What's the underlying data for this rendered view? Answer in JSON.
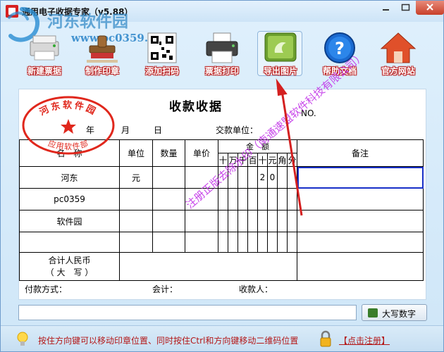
{
  "window": {
    "title": "通用电子收据专家（v5.88）",
    "watermark_title": "河东软件园",
    "watermark_url": "www.pc0359.cn"
  },
  "toolbar": {
    "items": [
      {
        "label": "新建票据",
        "icon": "printer-machine-icon"
      },
      {
        "label": "制作印章",
        "icon": "stamp-icon"
      },
      {
        "label": "添加扫码",
        "icon": "qr-code-icon"
      },
      {
        "label": "票据打印",
        "icon": "printer-icon"
      },
      {
        "label": "导出图片",
        "icon": "image-export-icon"
      },
      {
        "label": "帮助文档",
        "icon": "help-icon"
      },
      {
        "label": "官方网站",
        "icon": "home-icon"
      }
    ]
  },
  "receipt": {
    "title": "收款收据",
    "no_label": "NO.",
    "year_label": "年",
    "month_label": "月",
    "day_label": "日",
    "payer_label": "交款单位：",
    "headers": {
      "name": "名　称",
      "unit": "单位",
      "qty": "数量",
      "price": "单价",
      "amount": "金　额",
      "remark": "备注"
    },
    "amount_digits": [
      "十",
      "万",
      "千",
      "百",
      "十",
      "元",
      "角",
      "分"
    ],
    "rows": [
      {
        "name": "河东",
        "unit": "元",
        "amount_digits": [
          "",
          "",
          "",
          "",
          "2",
          "0",
          "",
          ""
        ]
      },
      {
        "name": "pc0359",
        "unit": "",
        "amount_digits": [
          "",
          "",
          "",
          "",
          "",
          "",
          "",
          ""
        ]
      },
      {
        "name": "软件园",
        "unit": "",
        "amount_digits": [
          "",
          "",
          "",
          "",
          "",
          "",
          "",
          ""
        ]
      },
      {
        "name": "",
        "unit": "",
        "amount_digits": [
          "",
          "",
          "",
          "",
          "",
          "",
          "",
          ""
        ]
      }
    ],
    "total_label_line1": "合计人民币",
    "total_label_line2": "（ 大　写 ）",
    "payment_method_label": "付款方式：",
    "accountant_label": "会计：",
    "payee_label": "收款人："
  },
  "seal": {
    "top_text": "河东软件园",
    "bottom_text": "应用软件部",
    "color": "#e0271c"
  },
  "diagonal_watermark": "注册正版去除水印（南通速盟软件科技有限公司）",
  "amount_input": {
    "value": ""
  },
  "upper_button": {
    "label": "大写数字"
  },
  "status": {
    "hint": "按住方向键可以移动印章位置、同时按住Ctrl和方向键移动二维码位置",
    "register_label": "【点击注册】"
  },
  "colors": {
    "arrow": "#d42020",
    "label_outline": "#b22222",
    "selection": "#1730c8",
    "watermark_purple": "#be28e6"
  }
}
